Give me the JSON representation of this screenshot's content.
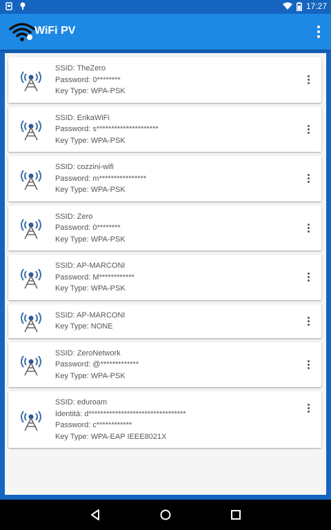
{
  "status": {
    "time": "17:27"
  },
  "appbar": {
    "title": "WiFi PV",
    "menu_icon": "more-vert-icon",
    "logo_icon": "wifi-logo-icon"
  },
  "networks": [
    {
      "lines": [
        "SSID: TheZero",
        "Password: 0********",
        "Key Type: WPA-PSK"
      ]
    },
    {
      "lines": [
        "SSID: ErikaWiFi",
        "Password: s*********************",
        "Key Type: WPA-PSK"
      ]
    },
    {
      "lines": [
        "SSID: cozzini-wifi",
        "Password: m****************",
        "Key Type: WPA-PSK"
      ]
    },
    {
      "lines": [
        "SSID: Zero",
        "Password: 0********",
        "Key Type: WPA-PSK"
      ]
    },
    {
      "lines": [
        "SSID: AP-MARCONI",
        "Password: M************",
        "Key Type: WPA-PSK"
      ]
    },
    {
      "lines": [
        "SSID: AP-MARCONI",
        "Key Type: NONE"
      ]
    },
    {
      "lines": [
        "SSID: ZeroNetwork",
        "Password: @*************",
        "Key Type: WPA-PSK"
      ]
    },
    {
      "lines": [
        "SSID: eduroam",
        "Identità: d*********************************",
        "Password: c************",
        "Key Type: WPA-EAP IEEE8021X"
      ]
    }
  ],
  "colors": {
    "accent": "#1e88e5",
    "status_bar": "#1565c0"
  }
}
